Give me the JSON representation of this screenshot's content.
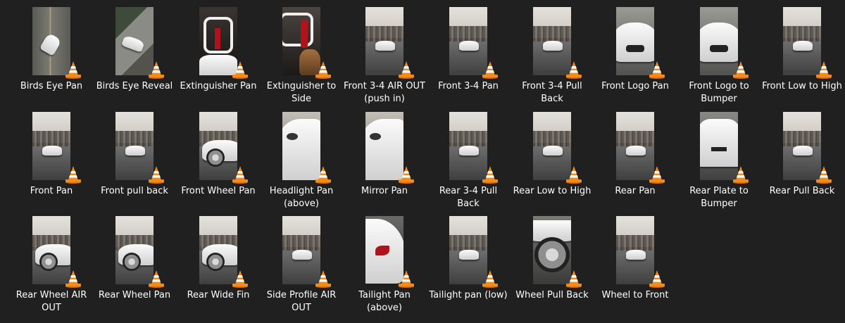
{
  "files": [
    {
      "name": "Birds Eye Pan",
      "scene": "aerial-road"
    },
    {
      "name": "Birds Eye Reveal",
      "scene": "aerial-lot"
    },
    {
      "name": "Extinguisher Pan",
      "scene": "interior-cage"
    },
    {
      "name": "Extinguisher to Side",
      "scene": "interior-red"
    },
    {
      "name": "Front 3-4 AIR OUT (push in)",
      "scene": "street-car"
    },
    {
      "name": "Front 3-4 Pan",
      "scene": "street-car"
    },
    {
      "name": "Front 3-4 Pull Back",
      "scene": "street-car"
    },
    {
      "name": "Front Logo Pan",
      "scene": "closeup-front"
    },
    {
      "name": "Front Logo to Bumper",
      "scene": "closeup-front"
    },
    {
      "name": "Front Low to High",
      "scene": "street-car"
    },
    {
      "name": "Front Pan",
      "scene": "street-car"
    },
    {
      "name": "Front pull back",
      "scene": "street-car"
    },
    {
      "name": "Front Wheel Pan",
      "scene": "wheel-side"
    },
    {
      "name": "Headlight Pan (above)",
      "scene": "closeup-hood"
    },
    {
      "name": "Mirror Pan",
      "scene": "closeup-hood"
    },
    {
      "name": "Rear 3-4 Pull Back",
      "scene": "street-car"
    },
    {
      "name": "Rear Low to High",
      "scene": "street-car"
    },
    {
      "name": "Rear Pan",
      "scene": "street-car"
    },
    {
      "name": "Rear Plate to Bumper",
      "scene": "closeup-rear"
    },
    {
      "name": "Rear Pull Back",
      "scene": "street-car"
    },
    {
      "name": "Rear Wheel AIR OUT",
      "scene": "wheel-side"
    },
    {
      "name": "Rear Wheel Pan",
      "scene": "wheel-side"
    },
    {
      "name": "Rear Wide Fin",
      "scene": "wheel-side"
    },
    {
      "name": "Side Profile AIR OUT",
      "scene": "street-car"
    },
    {
      "name": "Tailight Pan (above)",
      "scene": "closeup-tail"
    },
    {
      "name": "Tailight pan (low)",
      "scene": "street-car"
    },
    {
      "name": "Wheel Pull Back",
      "scene": "wheel-close"
    },
    {
      "name": "Wheel to Front",
      "scene": "street-car"
    }
  ],
  "icon": "vlc-cone-icon",
  "colors": {
    "background": "#202020",
    "text": "#ffffff",
    "vlc_orange": "#f38b1a"
  }
}
